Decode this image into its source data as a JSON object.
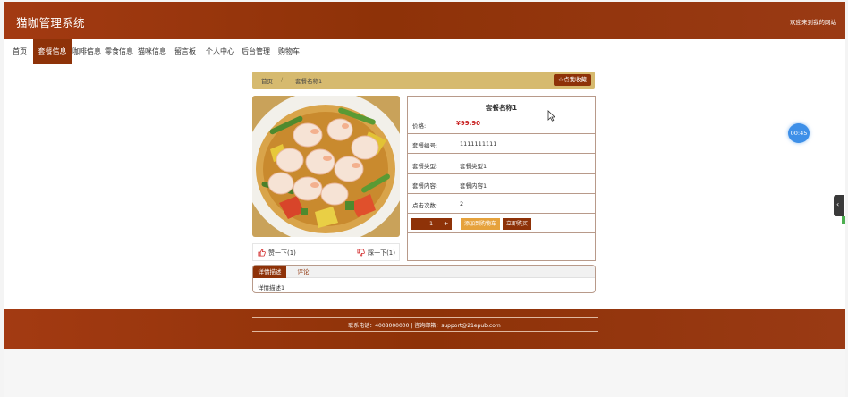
{
  "header": {
    "site_title": "猫咖管理系统",
    "welcome": "欢迎来到我的网站"
  },
  "nav": {
    "items": [
      {
        "label": "首页"
      },
      {
        "label": "套餐信息",
        "active": true
      },
      {
        "label": "咖啡信息"
      },
      {
        "label": "零食信息"
      },
      {
        "label": "猫咪信息"
      },
      {
        "label": "留言板"
      },
      {
        "label": "个人中心"
      },
      {
        "label": "后台管理"
      },
      {
        "label": "购物车"
      }
    ]
  },
  "breadcrumb": {
    "home": "首页",
    "separator": "/",
    "current": "套餐名称1",
    "favorite_button": "☆点我收藏"
  },
  "product": {
    "title": "套餐名称1",
    "rows": [
      {
        "label": "价格:",
        "value": "¥99.90"
      },
      {
        "label": "套餐编号:",
        "value": "1111111111"
      },
      {
        "label": "套餐类型:",
        "value": "套餐类型1"
      },
      {
        "label": "套餐内容:",
        "value": "套餐内容1"
      },
      {
        "label": "点击次数:",
        "value": "2"
      }
    ],
    "quantity": {
      "minus": "-",
      "value": "1",
      "plus": "+"
    },
    "add_to_cart": "添加到购物车",
    "buy_now": "立即购买"
  },
  "votes": {
    "like": "赞一下(1)",
    "dislike": "踩一下(1)"
  },
  "tabs": {
    "items": [
      {
        "label": "详情描述",
        "active": true
      },
      {
        "label": "评论"
      }
    ],
    "body": "详情描述1"
  },
  "footer": {
    "contact": "联系电话：4008000000 | 咨询邮箱：support@21epub.com"
  },
  "widgets": {
    "timer": "00:45",
    "side_toggle": "‹"
  },
  "colors": {
    "brand": "#8e3208",
    "crumb_bar": "#d6ba6f",
    "price": "#c81e1e",
    "cart_button": "#e6a23c",
    "timer": "#3d8fe8"
  }
}
